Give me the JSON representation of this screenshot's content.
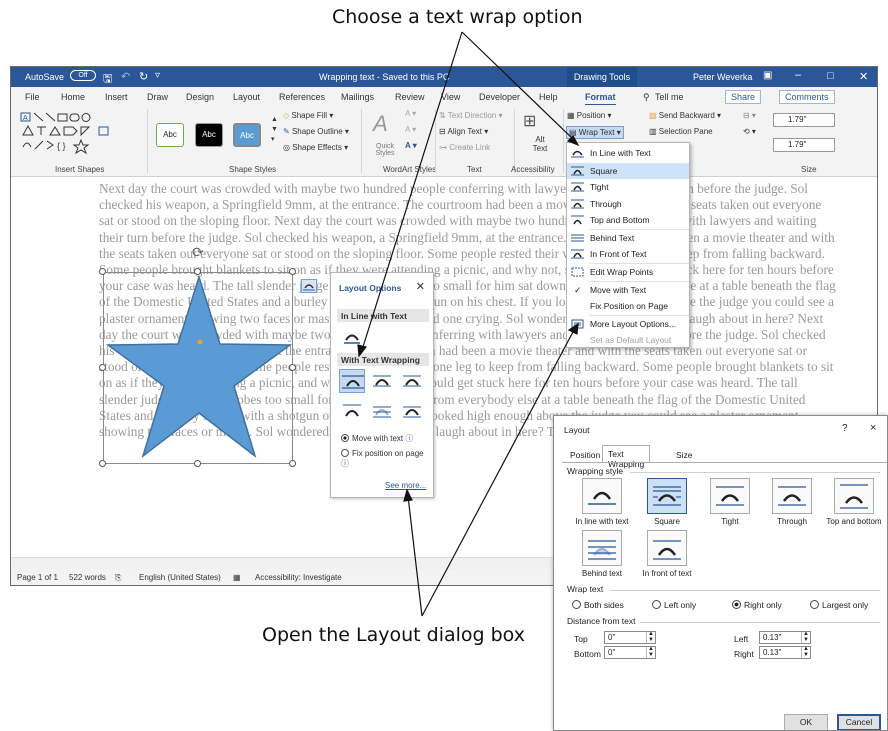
{
  "callouts": {
    "top": "Choose a text wrap option",
    "bottom": "Open the Layout dialog box"
  },
  "titlebar": {
    "autosave_label": "AutoSave",
    "autosave_state": "Off",
    "doc_title": "Wrapping text - Saved to this PC",
    "context_tab": "Drawing Tools",
    "user": "Peter Weverka"
  },
  "menu": {
    "items": [
      "File",
      "Home",
      "Insert",
      "Draw",
      "Design",
      "Layout",
      "References",
      "Mailings",
      "Review",
      "View",
      "Developer",
      "Help",
      "Format"
    ],
    "tell_me": "Tell me",
    "share": "Share",
    "comments": "Comments"
  },
  "ribbon": {
    "shape_fill": "Shape Fill",
    "shape_outline": "Shape Outline",
    "shape_effects": "Shape Effects",
    "style_samples": [
      "Abc",
      "Abc",
      "Abc"
    ],
    "quick_styles": "Quick Styles",
    "text_direction": "Text Direction",
    "align_text": "Align Text",
    "create_link": "Create Link",
    "alt_text": "Alt Text",
    "position": "Position",
    "wrap_text": "Wrap Text",
    "send_backward": "Send Backward",
    "selection_pane": "Selection Pane",
    "height": "1.79\"",
    "width": "1.79\"",
    "groups": [
      "Insert Shapes",
      "Shape Styles",
      "WordArt Styles",
      "Text",
      "Accessibility",
      "Size"
    ]
  },
  "document": {
    "body": "Next day the court was crowded with maybe two hundred people conferring with lawyers and waiting their turn before the judge. Sol checked his weapon, a Springfield 9mm, at the entrance. The courtroom had been a movie theater and with the seats taken out everyone sat or stood on the sloping floor. Next day the court was crowded with maybe two hundred people conferring with lawyers and waiting their turn before the judge. Sol checked his weapon, a Springfield 9mm, at the entrance. The courtroom had been a movie theater and with the seats taken out everyone sat or stood on the sloping floor. Some people rested their weight on one leg to keep from falling backward. Some people brought blankets to sit on as if they were attending a picnic, and why not, since you could get stuck here for ten hours before your case was heard. The tall slender judge with black robes too small for him sat downhill from everybody else at a table beneath the flag of the Domestic United States and a burley sheriff with a shotgun on his chest. If you looked high enough above the judge you could see a plaster ornament showing two faces or masks, one laughing and one crying. Sol wondered: What was there to laugh about in here? Next day the court was crowded with maybe two hundred people conferring with lawyers and waiting their turn before the judge. Sol checked his weapon, a Springfield 9mm, at the entrance. The courtroom had been a movie theater and with the seats taken out everyone sat or stood on the sloping floor. Some people rested their weight on one leg to keep from falling backward. Some people brought blankets to sit on as if they were attending a picnic, and why not, since you could get stuck here for ten hours before your case was heard. The tall slender judge with black robes too small for him sat downhill from everybody else at a table beneath the flag of the Domestic United States and a burley sheriff with a shotgun on his chest. If you looked high enough above the judge you could see a plaster ornament showing two faces or masks. Sol wondered: What was there to laugh about in here? These other"
  },
  "status": {
    "page": "Page 1 of 1",
    "words": "522 words",
    "language": "English (United States)",
    "accessibility": "Accessibility: Investigate"
  },
  "layout_options": {
    "title": "Layout Options",
    "inline_header": "In Line with Text",
    "wrapping_header": "With Text Wrapping",
    "move_with_text": "Move with text",
    "fix_position": "Fix position on page",
    "see_more": "See more..."
  },
  "wrap_menu": {
    "items": [
      "In Line with Text",
      "Square",
      "Tight",
      "Through",
      "Top and Bottom",
      "Behind Text",
      "In Front of Text",
      "Edit Wrap Points",
      "Move with Text",
      "Fix Position on Page",
      "More Layout Options...",
      "Set as Default Layout"
    ]
  },
  "dialog": {
    "title": "Layout",
    "help": "?",
    "close": "×",
    "tabs": [
      "Position",
      "Text Wrapping",
      "Size"
    ],
    "wrapping_style_label": "Wrapping style",
    "styles": [
      "In line with text",
      "Square",
      "Tight",
      "Through",
      "Top and bottom",
      "Behind text",
      "In front of text"
    ],
    "wrap_text_label": "Wrap text",
    "wrap_options": [
      "Both sides",
      "Left only",
      "Right only",
      "Largest only"
    ],
    "distance_label": "Distance from text",
    "top_label": "Top",
    "top_value": "0\"",
    "bottom_label": "Bottom",
    "bottom_value": "0\"",
    "left_label": "Left",
    "left_value": "0.13\"",
    "right_label": "Right",
    "right_value": "0.13\"",
    "ok": "OK",
    "cancel": "Cancel"
  },
  "colors": {
    "title_blue": "#2b579a",
    "star_fill": "#5b9bd5",
    "star_stroke": "#41719c",
    "body_text": "#9a9a9a"
  }
}
